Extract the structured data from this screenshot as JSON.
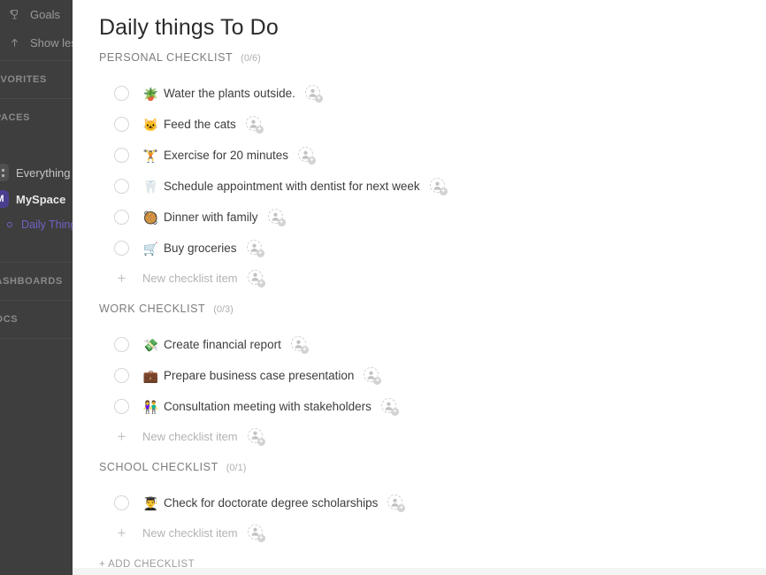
{
  "sidebar": {
    "nav_items": [
      {
        "label": "Goals",
        "icon": "trophy-icon"
      },
      {
        "label": "Show less",
        "icon": "arrow-up-icon"
      }
    ],
    "sections": [
      {
        "label": "FAVORITES"
      },
      {
        "label": "SPACES"
      }
    ],
    "spaces": [
      {
        "label": "Everything",
        "badge": "",
        "badge_kind": "grid",
        "active": false
      },
      {
        "label": "MySpace",
        "badge": "M",
        "badge_kind": "my",
        "active": true
      }
    ],
    "documents": [
      {
        "label": "Daily Thing"
      }
    ],
    "lower_sections": [
      {
        "label": "DASHBOARDS"
      },
      {
        "label": "DOCS"
      }
    ],
    "colors": {
      "background": "#3e3e3e",
      "myspace_badge": "#4a3f8f",
      "doc_active": "#6f64c6"
    }
  },
  "main": {
    "page_title": "Daily things To Do",
    "add_checklist_label": "+ ADD CHECKLIST",
    "new_item_placeholder": "New checklist item",
    "checklists": [
      {
        "title": "PERSONAL CHECKLIST",
        "count": "(0/6)",
        "items": [
          {
            "emoji": "🪴",
            "emoji_name": "potted-plant-emoji",
            "text": "Water the plants outside.",
            "checked": false
          },
          {
            "emoji": "🐱",
            "emoji_name": "cat-face-emoji",
            "text": "Feed the cats",
            "checked": false
          },
          {
            "emoji": "🏋️",
            "emoji_name": "weightlifter-emoji",
            "text": "Exercise for 20 minutes",
            "checked": false
          },
          {
            "emoji": "🦷",
            "emoji_name": "tooth-emoji",
            "text": "Schedule appointment with dentist for next week",
            "checked": false
          },
          {
            "emoji": "🥘",
            "emoji_name": "paella-emoji",
            "text": "Dinner with family",
            "checked": false
          },
          {
            "emoji": "🛒",
            "emoji_name": "shopping-cart-emoji",
            "text": "Buy groceries",
            "checked": false
          }
        ]
      },
      {
        "title": "WORK CHECKLIST",
        "count": "(0/3)",
        "items": [
          {
            "emoji": "💸",
            "emoji_name": "money-with-wings-emoji",
            "text": "Create financial report",
            "checked": false
          },
          {
            "emoji": "💼",
            "emoji_name": "briefcase-emoji",
            "text": "Prepare business case presentation",
            "checked": false
          },
          {
            "emoji": "👫",
            "emoji_name": "people-emoji",
            "text": "Consultation meeting with stakeholders",
            "checked": false
          }
        ]
      },
      {
        "title": "SCHOOL CHECKLIST",
        "count": "(0/1)",
        "items": [
          {
            "emoji": "👨‍🎓",
            "emoji_name": "graduate-emoji",
            "text": "Check for doctorate degree scholarships",
            "checked": false
          }
        ]
      }
    ]
  }
}
